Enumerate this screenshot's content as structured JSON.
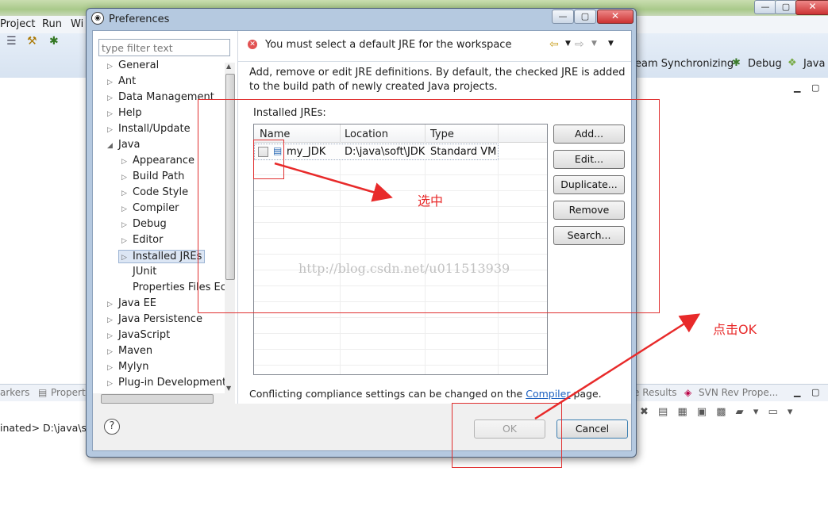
{
  "background": {
    "menu": [
      "Project",
      "Run",
      "Wi"
    ],
    "perspectives": [
      "eam Synchronizing",
      "Debug",
      "Java"
    ],
    "bottom_tabs_left": [
      "arkers",
      "Propert"
    ],
    "bottom_tabs_right": [
      "e Results",
      "SVN Rev Prope..."
    ],
    "console_text": "inated> D:\\java\\so"
  },
  "dialog": {
    "title": "Preferences",
    "filter_placeholder": "type filter text",
    "tree": [
      {
        "label": "General",
        "arrow": "▷"
      },
      {
        "label": "Ant",
        "arrow": "▷"
      },
      {
        "label": "Data Management",
        "arrow": "▷"
      },
      {
        "label": "Help",
        "arrow": "▷"
      },
      {
        "label": "Install/Update",
        "arrow": "▷"
      },
      {
        "label": "Java",
        "arrow": "◢"
      },
      {
        "label": "Appearance",
        "arrow": "▷"
      },
      {
        "label": "Build Path",
        "arrow": "▷"
      },
      {
        "label": "Code Style",
        "arrow": "▷"
      },
      {
        "label": "Compiler",
        "arrow": "▷"
      },
      {
        "label": "Debug",
        "arrow": "▷"
      },
      {
        "label": "Editor",
        "arrow": "▷"
      },
      {
        "label": "Installed JREs",
        "arrow": "▷",
        "selected": true
      },
      {
        "label": "JUnit",
        "arrow": ""
      },
      {
        "label": "Properties Files Ec",
        "arrow": ""
      },
      {
        "label": "Java EE",
        "arrow": "▷"
      },
      {
        "label": "Java Persistence",
        "arrow": "▷"
      },
      {
        "label": "JavaScript",
        "arrow": "▷"
      },
      {
        "label": "Maven",
        "arrow": "▷"
      },
      {
        "label": "Mylyn",
        "arrow": "▷"
      },
      {
        "label": "Plug-in Development",
        "arrow": "▷"
      }
    ],
    "error_message": "You must select a default JRE for the workspace",
    "description": "Add, remove or edit JRE definitions. By default, the checked JRE is added to the build path of newly created Java projects.",
    "installed_label": "Installed JREs:",
    "columns": [
      "Name",
      "Location",
      "Type"
    ],
    "jres": [
      {
        "name": "my_JDK",
        "location": "D:\\java\\soft\\JDK",
        "type": "Standard VM"
      }
    ],
    "buttons": {
      "add": "Add...",
      "edit": "Edit...",
      "duplicate": "Duplicate...",
      "remove": "Remove",
      "search": "Search..."
    },
    "compliance_prefix": "Conflicting compliance settings can be changed on the ",
    "compliance_link": "Compiler",
    "compliance_suffix": " page.",
    "ok": "OK",
    "cancel": "Cancel",
    "help": "?"
  },
  "annotations": {
    "select_text": "选中",
    "click_ok_text": "点击OK",
    "watermark": "http://blog.csdn.net/u011513939",
    "color": "#e82a2a"
  }
}
